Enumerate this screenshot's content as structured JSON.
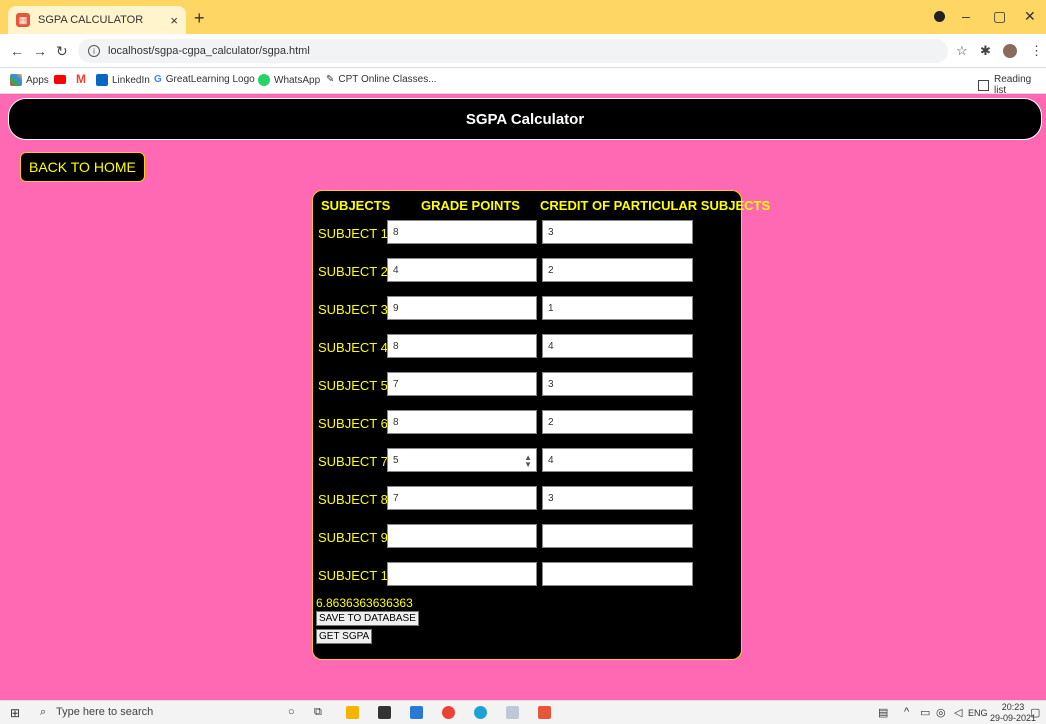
{
  "browser": {
    "tab_title": "SGPA CALCULATOR",
    "tab_close": "×",
    "new_tab": "+",
    "url": "localhost/sgpa-cgpa_calculator/sgpa.html",
    "bookmarks": [
      "Apps",
      "LinkedIn",
      "GreatLearning Logo",
      "WhatsApp",
      "CPT Online Classes..."
    ],
    "reading_list": "Reading list"
  },
  "page": {
    "title": "SGPA Calculator",
    "back_button": "BACK TO HOME",
    "headers": [
      "SUBJECTS",
      "GRADE POINTS",
      "CREDIT OF PARTICULAR SUBJECTS"
    ],
    "subjects": [
      {
        "label": "SUBJECT 1",
        "grade": "8",
        "credit": "3"
      },
      {
        "label": "SUBJECT 2",
        "grade": "4",
        "credit": "2"
      },
      {
        "label": "SUBJECT 3",
        "grade": "9",
        "credit": "1"
      },
      {
        "label": "SUBJECT 4",
        "grade": "8",
        "credit": "4"
      },
      {
        "label": "SUBJECT 5",
        "grade": "7",
        "credit": "3"
      },
      {
        "label": "SUBJECT 6",
        "grade": "8",
        "credit": "2"
      },
      {
        "label": "SUBJECT 7",
        "grade": "5",
        "credit": "4"
      },
      {
        "label": "SUBJECT 8",
        "grade": "7",
        "credit": "3"
      },
      {
        "label": "SUBJECT 9",
        "grade": "",
        "credit": ""
      },
      {
        "label": "SUBJECT 10",
        "grade": "",
        "credit": ""
      }
    ],
    "result": "6.8636363636363",
    "save_button": "SAVE TO DATABASE",
    "get_button": "GET SGPA"
  },
  "taskbar": {
    "search_placeholder": "Type here to search",
    "language": "ENG",
    "time": "20:23",
    "date": "29-09-2021"
  },
  "colors": {
    "page_background": "#ff69b4",
    "panel": "#000000",
    "label_text": "#ffff00",
    "tab_bar": "#fdd663"
  }
}
